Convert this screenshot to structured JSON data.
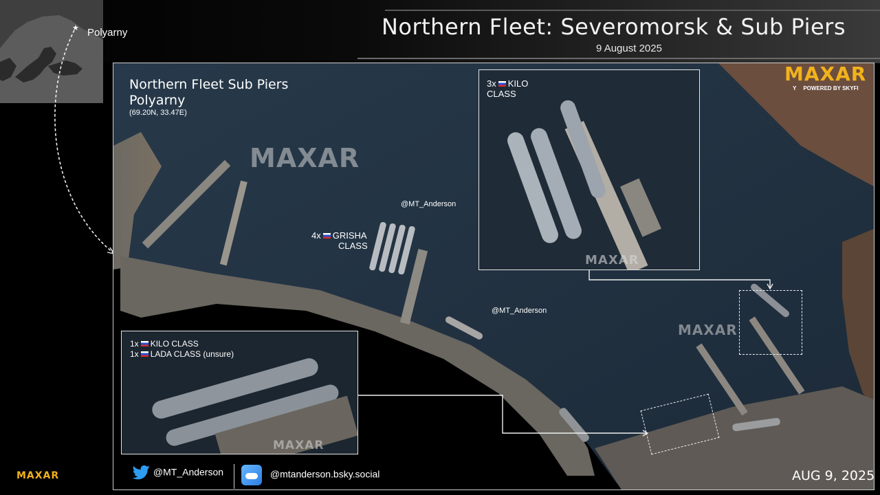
{
  "header": {
    "title": "Northern Fleet: Severomorsk & Sub Piers",
    "date": "9 August 2025"
  },
  "inset_map": {
    "location_label": "Polyarny"
  },
  "image_panel": {
    "location_title": "Northern Fleet Sub Piers",
    "location_name": "Polyarny",
    "coordinates": "(69.20N, 33.47E)",
    "watermark": "MAXAR",
    "handle_label_1": "@MT_Anderson",
    "handle_label_2": "@MT_Anderson",
    "grisha_label_line1": "4x",
    "grisha_label_line1b": "GRISHA",
    "grisha_label_line2": "CLASS",
    "date_stamp": "AUG 9, 2025"
  },
  "detail_kilo_3": {
    "line1_count": "3x",
    "line1_text": "KILO",
    "line2": "CLASS",
    "watermark": "MAXAR"
  },
  "detail_kilo_lada": {
    "line1_count": "1x",
    "line1_text": "KILO CLASS",
    "line2_count": "1x",
    "line2_text": "LADA CLASS (unsure)",
    "watermark": "MAXAR"
  },
  "brand": {
    "logo": "MAXAR",
    "powered_by": "POWERED BY SKYFI",
    "corner_logo": "MAXAR",
    "accent_color": "#f2b21b"
  },
  "footer": {
    "twitter_handle": "@MT_Anderson",
    "bsky_handle": "@mtanderson.bsky.social",
    "twitter_icon": "twitter-bird-icon",
    "bsky_icon": "bluesky-icon"
  }
}
